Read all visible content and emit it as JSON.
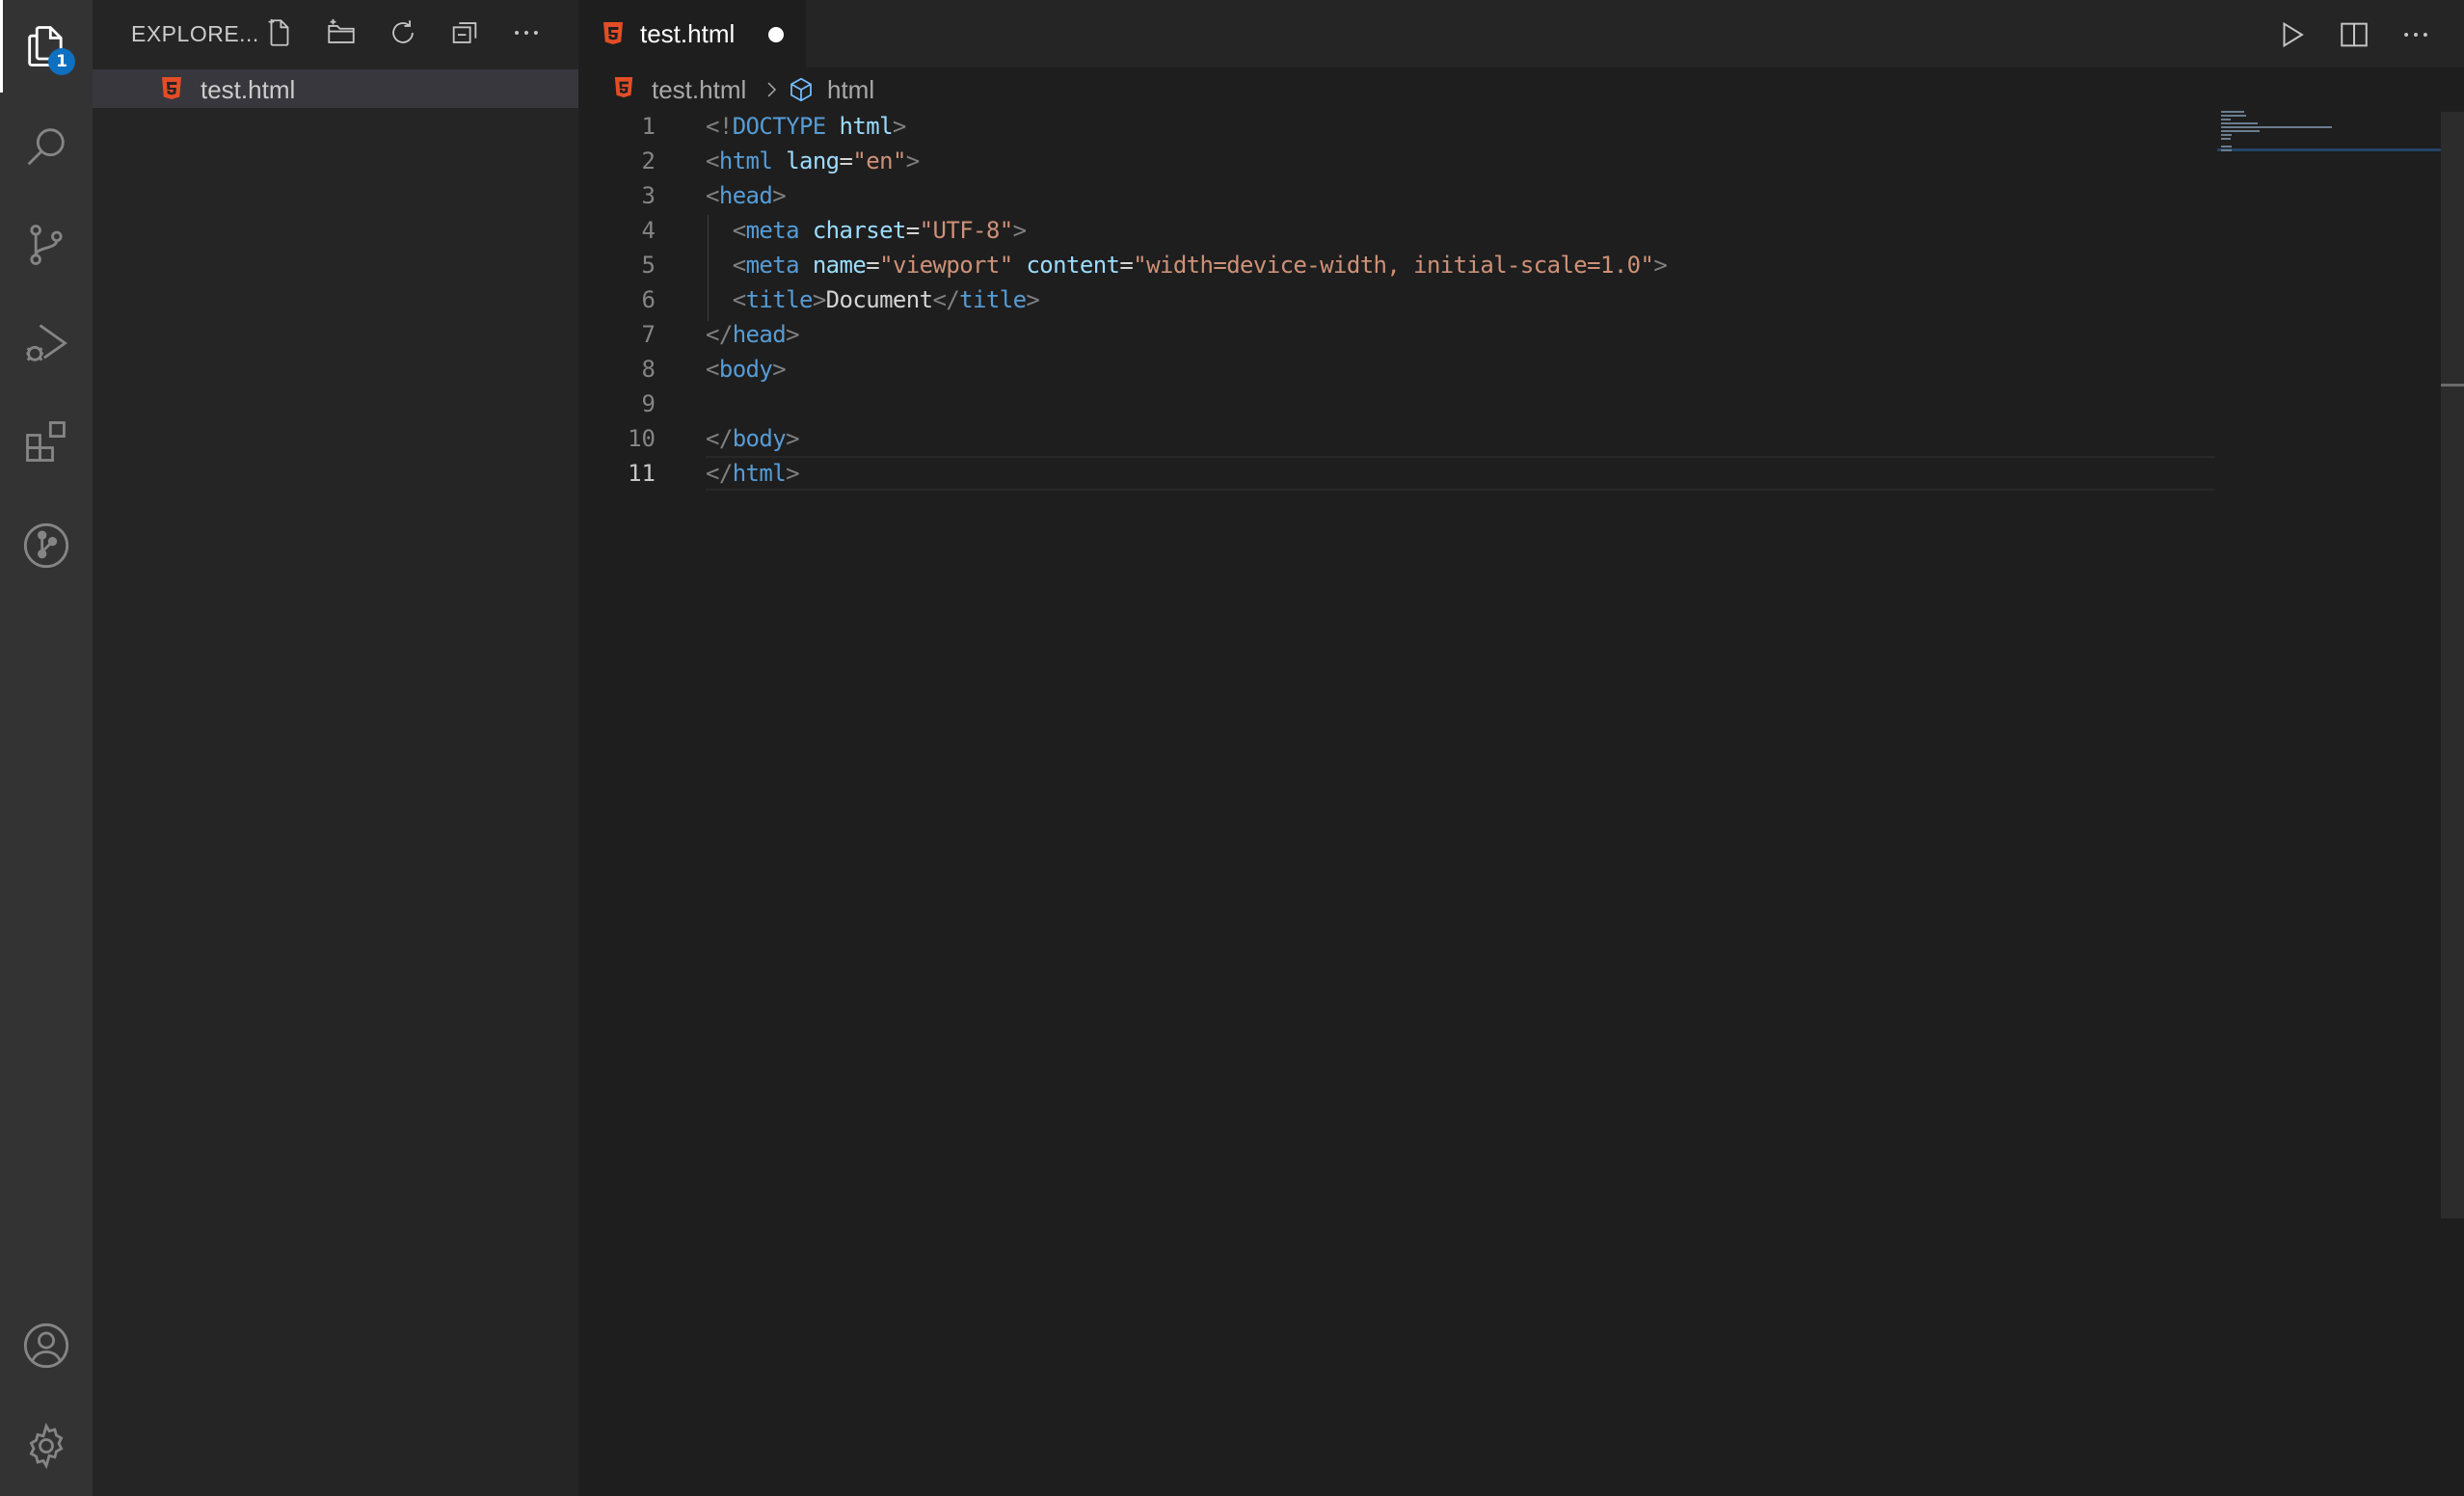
{
  "activity_bar": {
    "explorer_badge": "1",
    "items": [
      "explorer-icon",
      "search-icon",
      "source-control-icon",
      "run-debug-icon",
      "extensions-icon",
      "git-graph-icon"
    ],
    "bottom_items": [
      "account-icon",
      "settings-gear-icon"
    ]
  },
  "sidebar": {
    "title": "EXPLORE...",
    "actions": [
      "new-file-icon",
      "new-folder-icon",
      "refresh-icon",
      "collapse-all-icon",
      "more-icon"
    ],
    "files": [
      {
        "name": "test.html",
        "icon": "html5-icon"
      }
    ]
  },
  "editor": {
    "tab": {
      "label": "test.html",
      "modified": true,
      "icon": "html5-icon"
    },
    "top_actions": [
      "run-icon",
      "split-editor-icon",
      "more-icon"
    ],
    "breadcrumb": {
      "file": "test.html",
      "symbol": "html"
    },
    "current_line": 11,
    "lines": [
      {
        "n": "1",
        "tokens": [
          [
            "p",
            "<!"
          ],
          [
            "t",
            "DOCTYPE"
          ],
          [
            "x",
            " "
          ],
          [
            "a",
            "html"
          ],
          [
            "p",
            ">"
          ]
        ]
      },
      {
        "n": "2",
        "tokens": [
          [
            "p",
            "<"
          ],
          [
            "t",
            "html"
          ],
          [
            "x",
            " "
          ],
          [
            "a",
            "lang"
          ],
          [
            "x",
            "="
          ],
          [
            "s",
            "\"en\""
          ],
          [
            "p",
            ">"
          ]
        ]
      },
      {
        "n": "3",
        "tokens": [
          [
            "p",
            "<"
          ],
          [
            "t",
            "head"
          ],
          [
            "p",
            ">"
          ]
        ]
      },
      {
        "n": "4",
        "tokens": [
          [
            "x",
            "  "
          ],
          [
            "p",
            "<"
          ],
          [
            "t",
            "meta"
          ],
          [
            "x",
            " "
          ],
          [
            "a",
            "charset"
          ],
          [
            "x",
            "="
          ],
          [
            "s",
            "\"UTF-8\""
          ],
          [
            "p",
            ">"
          ]
        ]
      },
      {
        "n": "5",
        "tokens": [
          [
            "x",
            "  "
          ],
          [
            "p",
            "<"
          ],
          [
            "t",
            "meta"
          ],
          [
            "x",
            " "
          ],
          [
            "a",
            "name"
          ],
          [
            "x",
            "="
          ],
          [
            "s",
            "\"viewport\""
          ],
          [
            "x",
            " "
          ],
          [
            "a",
            "content"
          ],
          [
            "x",
            "="
          ],
          [
            "s",
            "\"width=device-width, initial-scale=1.0\""
          ],
          [
            "p",
            ">"
          ]
        ]
      },
      {
        "n": "6",
        "tokens": [
          [
            "x",
            "  "
          ],
          [
            "p",
            "<"
          ],
          [
            "t",
            "title"
          ],
          [
            "p",
            ">"
          ],
          [
            "x",
            "Document"
          ],
          [
            "p",
            "</"
          ],
          [
            "t",
            "title"
          ],
          [
            "p",
            ">"
          ]
        ]
      },
      {
        "n": "7",
        "tokens": [
          [
            "p",
            "</"
          ],
          [
            "t",
            "head"
          ],
          [
            "p",
            ">"
          ]
        ]
      },
      {
        "n": "8",
        "tokens": [
          [
            "p",
            "<"
          ],
          [
            "t",
            "body"
          ],
          [
            "p",
            ">"
          ]
        ]
      },
      {
        "n": "9",
        "tokens": []
      },
      {
        "n": "10",
        "tokens": [
          [
            "p",
            "</"
          ],
          [
            "t",
            "body"
          ],
          [
            "p",
            ">"
          ]
        ]
      },
      {
        "n": "11",
        "tokens": [
          [
            "p",
            "</"
          ],
          [
            "t",
            "html"
          ],
          [
            "p",
            ">"
          ]
        ]
      }
    ]
  },
  "colors": {
    "tag": "#569cd6",
    "attribute": "#9cdcfe",
    "string": "#ce9178",
    "punctuation": "#808080",
    "text": "#d4d4d4",
    "badge": "#0e70c0",
    "html_icon": "#e44d26"
  }
}
